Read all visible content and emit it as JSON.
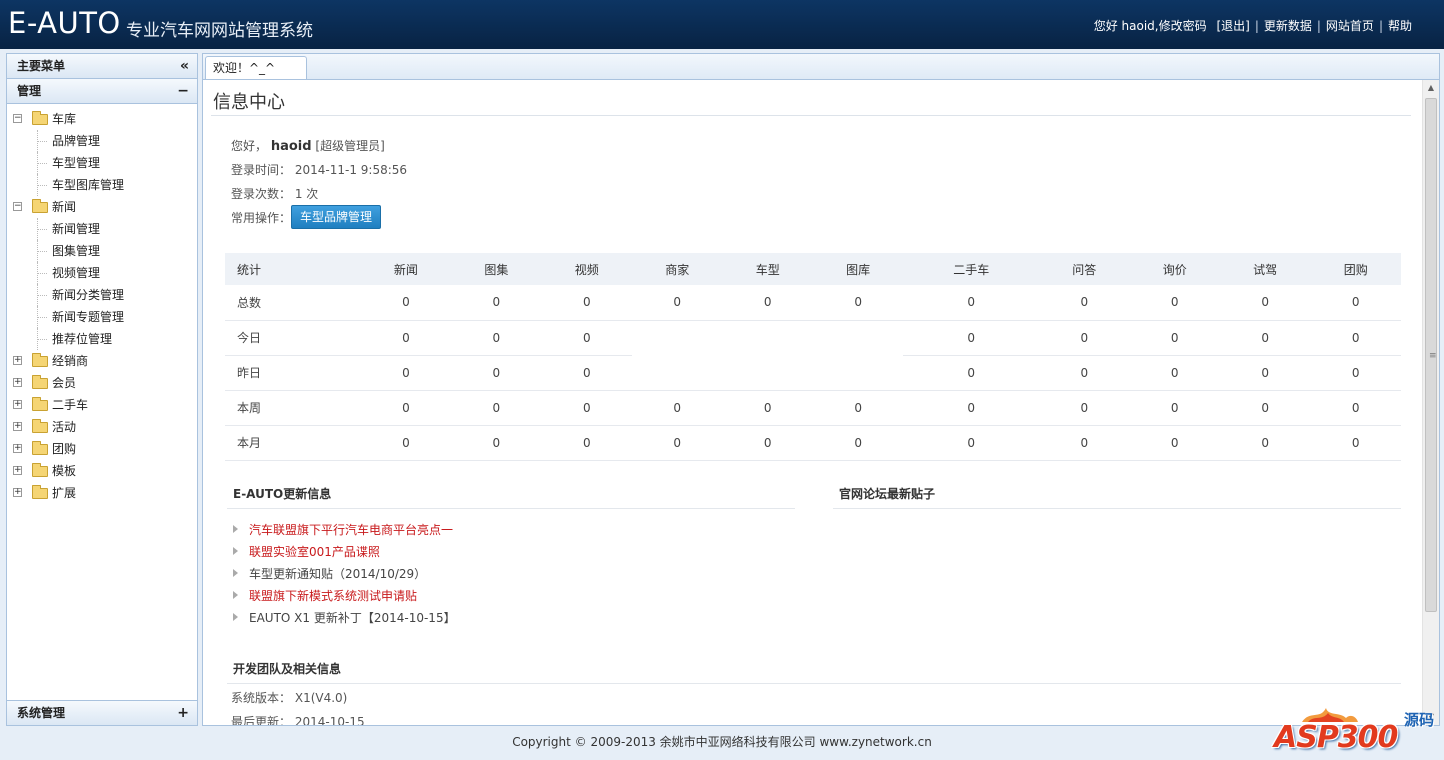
{
  "header": {
    "logo": "E-AUTO",
    "subtitle": "专业汽车网网站管理系统",
    "greeting": "您好 haoid,",
    "change_password": "修改密码",
    "logout": "[退出]",
    "update_data": "更新数据",
    "site_home": "网站首页",
    "help": "帮助"
  },
  "sidebar": {
    "main_menu": "主要菜单",
    "collapse_symbol": "«",
    "manage_title": "管理",
    "manage_symbol": "−",
    "tree": [
      {
        "label": "车库",
        "expanded": true,
        "children": [
          "品牌管理",
          "车型管理",
          "车型图库管理"
        ]
      },
      {
        "label": "新闻",
        "expanded": true,
        "children": [
          "新闻管理",
          "图集管理",
          "视频管理",
          "新闻分类管理",
          "新闻专题管理",
          "推荐位管理"
        ]
      },
      {
        "label": "经销商",
        "expanded": false,
        "children": []
      },
      {
        "label": "会员",
        "expanded": false,
        "children": []
      },
      {
        "label": "二手车",
        "expanded": false,
        "children": []
      },
      {
        "label": "活动",
        "expanded": false,
        "children": []
      },
      {
        "label": "团购",
        "expanded": false,
        "children": []
      },
      {
        "label": "模板",
        "expanded": false,
        "children": []
      },
      {
        "label": "扩展",
        "expanded": false,
        "children": []
      }
    ],
    "system_title": "系统管理",
    "system_symbol": "+"
  },
  "tabs": {
    "welcome": "欢迎！^_^"
  },
  "info": {
    "title": "信息中心",
    "hello_prefix": "您好，",
    "username": "haoid",
    "role": "[超级管理员]",
    "login_time_label": "登录时间：",
    "login_time": "2014-11-1 9:58:56",
    "login_count_label": "登录次数：",
    "login_count": "1 次",
    "common_ops_label": "常用操作：",
    "quick_button": "车型品牌管理"
  },
  "stats": {
    "headers": [
      "统计",
      "新闻",
      "图集",
      "视频",
      "商家",
      "车型",
      "图库",
      "二手车",
      "问答",
      "询价",
      "试驾",
      "团购"
    ],
    "rows": [
      [
        "总数",
        "0",
        "0",
        "0",
        "0",
        "0",
        "0",
        "0",
        "0",
        "0",
        "0",
        "0"
      ],
      [
        "今日",
        "0",
        "0",
        "0",
        "",
        "",
        "",
        "0",
        "0",
        "0",
        "0",
        "0"
      ],
      [
        "昨日",
        "0",
        "0",
        "0",
        "",
        "",
        "",
        "0",
        "0",
        "0",
        "0",
        "0"
      ],
      [
        "本周",
        "0",
        "0",
        "0",
        "0",
        "0",
        "0",
        "0",
        "0",
        "0",
        "0",
        "0"
      ],
      [
        "本月",
        "0",
        "0",
        "0",
        "0",
        "0",
        "0",
        "0",
        "0",
        "0",
        "0",
        "0"
      ]
    ]
  },
  "updates": {
    "title": "E-AUTO更新信息",
    "items": [
      {
        "text": "汽车联盟旗下平行汽车电商平台亮点一",
        "highlight": true
      },
      {
        "text": "联盟实验室001产品谍照",
        "highlight": true
      },
      {
        "text": "车型更新通知贴（2014/10/29）",
        "highlight": false
      },
      {
        "text": "联盟旗下新模式系统测试申请贴",
        "highlight": true
      },
      {
        "text": "EAUTO X1 更新补丁【2014-10-15】",
        "highlight": false
      }
    ]
  },
  "forum": {
    "title": "官网论坛最新贴子"
  },
  "team": {
    "title": "开发团队及相关信息",
    "version_label": "系统版本：",
    "version": "X1(V4.0)",
    "last_update_label": "最后更新：",
    "last_update": "2014-10-15"
  },
  "footer": {
    "copyright": "Copyright © 2009-2013 余姚市中亚网络科技有限公司 www.zynetwork.cn"
  },
  "watermark": {
    "text": "ASP300",
    "code": "源码"
  }
}
